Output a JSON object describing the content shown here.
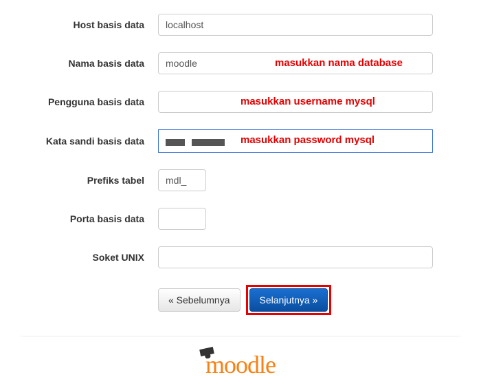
{
  "fields": {
    "dbhost": {
      "label": "Host basis data",
      "value": "localhost"
    },
    "dbname": {
      "label": "Nama basis data",
      "value": "moodle",
      "annotation": "masukkan nama database"
    },
    "dbuser": {
      "label": "Pengguna basis data",
      "value": "",
      "annotation": "masukkan username mysql"
    },
    "dbpass": {
      "label": "Kata sandi basis data",
      "value": "",
      "annotation": "masukkan password mysql",
      "masked": true
    },
    "prefix": {
      "label": "Prefiks tabel",
      "value": "mdl_"
    },
    "dbport": {
      "label": "Porta basis data",
      "value": ""
    },
    "dbsocket": {
      "label": "Soket UNIX",
      "value": ""
    }
  },
  "buttons": {
    "prev": "« Sebelumnya",
    "next": "Selanjutnya »"
  },
  "logo": "moodle"
}
